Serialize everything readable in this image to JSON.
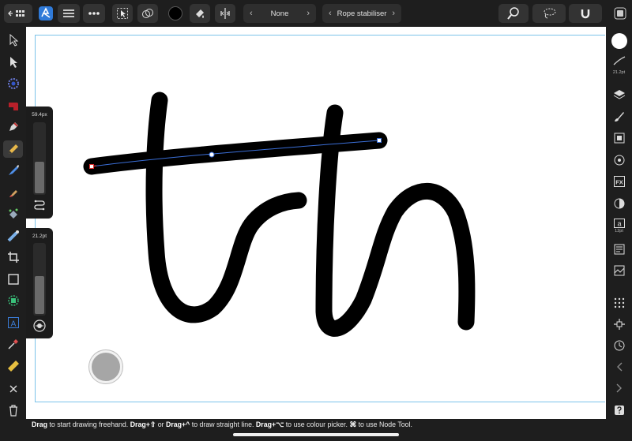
{
  "toolbar": {
    "stroke_mode": "None",
    "stabiliser_mode": "Rope stabiliser"
  },
  "sliders": {
    "width_value": "59.4px",
    "width_level": 0.45,
    "opacity_value": "21.2pt",
    "opacity_level": 0.55
  },
  "studio": {
    "stroke_size_label": "21.2pt",
    "text_size_label": "12pt",
    "text_icon_letter": "a",
    "fx_label": "FX",
    "text_frame_letter": "A"
  },
  "context_hint": {
    "p1_bold": "Drag",
    "p1": " to start drawing freehand. ",
    "p2_bold": "Drag+⇧",
    "p2": " or ",
    "p3_bold": "Drag+^",
    "p3": " to draw straight line. ",
    "p4_bold": "Drag+⌥",
    "p4": " to use colour picker. ",
    "p5_bold": "⌘",
    "p5": " to use Node Tool."
  },
  "colors": {
    "accent": "#3b7dd8",
    "stroke": "#000000",
    "selection_line": "#3b6fd8",
    "doc_border": "#7cc3ea",
    "puck_fill": "#a6a6a6"
  },
  "icons": {
    "back": "back-grid-icon",
    "app": "designer-persona-icon",
    "menu": "hamburger-menu-icon",
    "more": "more-dots-icon",
    "select": "selection-icon",
    "snapping": "snapping-icon",
    "colour": "colour-swatch-icon",
    "brush": "brush-icon",
    "align": "align-icon",
    "zoom": "zoom-icon",
    "lasso": "lasso-icon",
    "magnet": "magnet-icon",
    "fullscreen": "fullscreen-icon"
  }
}
